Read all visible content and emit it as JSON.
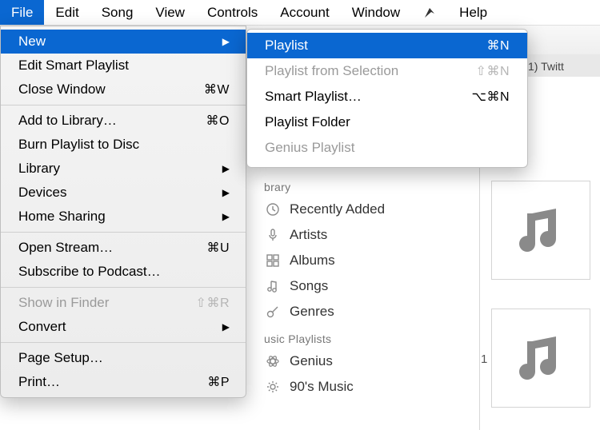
{
  "menubar": {
    "items": [
      "File",
      "Edit",
      "Song",
      "View",
      "Controls",
      "Account",
      "Window"
    ],
    "help": "Help",
    "activeIndex": 0
  },
  "toolbar": {
    "tab_badge": "1) Twitt"
  },
  "fileMenu": {
    "groups": [
      [
        {
          "label": "New",
          "submenu": true,
          "highlighted": true
        },
        {
          "label": "Edit Smart Playlist"
        },
        {
          "label": "Close Window",
          "shortcut": "⌘W"
        }
      ],
      [
        {
          "label": "Add to Library…",
          "shortcut": "⌘O"
        },
        {
          "label": "Burn Playlist to Disc"
        },
        {
          "label": "Library",
          "submenu": true
        },
        {
          "label": "Devices",
          "submenu": true
        },
        {
          "label": "Home Sharing",
          "submenu": true
        }
      ],
      [
        {
          "label": "Open Stream…",
          "shortcut": "⌘U"
        },
        {
          "label": "Subscribe to Podcast…"
        }
      ],
      [
        {
          "label": "Show in Finder",
          "shortcut": "⇧⌘R",
          "disabled": true
        },
        {
          "label": "Convert",
          "submenu": true
        }
      ],
      [
        {
          "label": "Page Setup…"
        },
        {
          "label": "Print…",
          "shortcut": "⌘P"
        }
      ]
    ]
  },
  "newSubmenu": {
    "items": [
      {
        "label": "Playlist",
        "shortcut": "⌘N",
        "highlighted": true
      },
      {
        "label": "Playlist from Selection",
        "shortcut": "⇧⌘N",
        "disabled": true
      },
      {
        "label": "Smart Playlist…",
        "shortcut": "⌥⌘N"
      },
      {
        "label": "Playlist Folder"
      },
      {
        "label": "Genius Playlist",
        "disabled": true
      }
    ]
  },
  "sidebar": {
    "librarySection": "brary",
    "libraryItems": [
      {
        "icon": "clock",
        "label": "Recently Added"
      },
      {
        "icon": "mic",
        "label": "Artists"
      },
      {
        "icon": "grid",
        "label": "Albums"
      },
      {
        "icon": "note",
        "label": "Songs"
      },
      {
        "icon": "guitar",
        "label": "Genres"
      }
    ],
    "playlistSection": "usic Playlists",
    "playlistItems": [
      {
        "icon": "atom",
        "label": "Genius"
      },
      {
        "icon": "gear",
        "label": "90's Music"
      }
    ]
  },
  "rightpane": {
    "items": [
      {
        "num": ""
      },
      {
        "num": "1"
      }
    ]
  }
}
